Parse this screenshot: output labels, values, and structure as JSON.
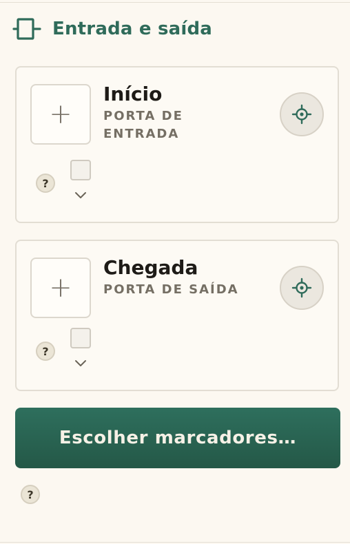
{
  "header": {
    "title": "Entrada e saída",
    "icon": "entry-exit-icon"
  },
  "cards": [
    {
      "title": "Início",
      "subtitle": "PORTA DE ENTRADA",
      "add_symbol": "+",
      "help_symbol": "?"
    },
    {
      "title": "Chegada",
      "subtitle": "PORTA DE SAÍDA",
      "add_symbol": "+",
      "help_symbol": "?"
    }
  ],
  "actions": {
    "choose_markers_label": "Escolher marcadores…",
    "help_symbol": "?"
  },
  "colors": {
    "accent": "#2f6b5a",
    "background": "#fcf8f1",
    "button": "#2a6553"
  }
}
